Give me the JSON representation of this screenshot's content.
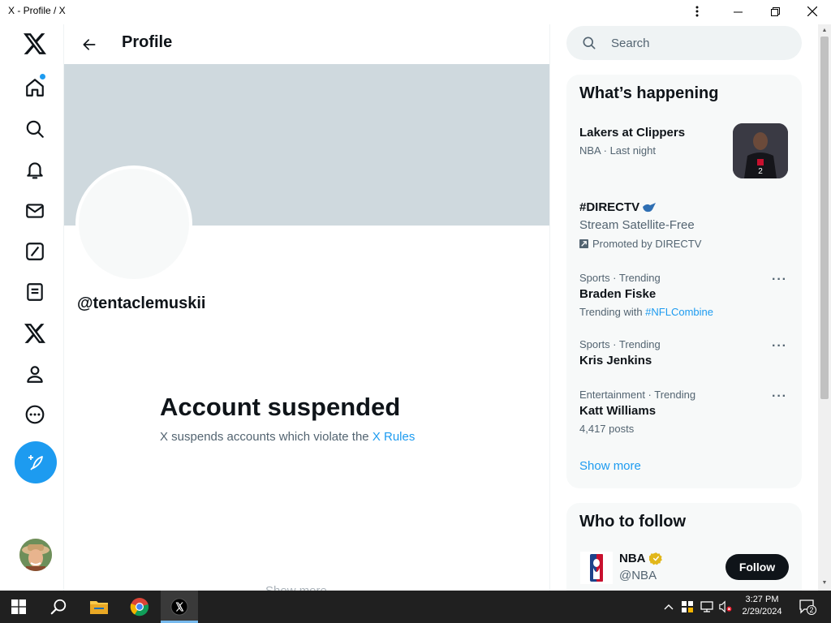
{
  "window": {
    "title": "X - Profile / X"
  },
  "nav": {
    "items": [
      "logo",
      "home",
      "explore",
      "notifications",
      "messages",
      "grok",
      "lists",
      "premium",
      "profile",
      "more"
    ],
    "post_button": "Post"
  },
  "main": {
    "title": "Profile",
    "handle": "@tentaclemuskii",
    "suspended_title": "Account suspended",
    "suspended_text": "X suspends accounts which violate the ",
    "suspended_link": "X Rules",
    "ghost_text": "Show more"
  },
  "search": {
    "placeholder": "Search"
  },
  "happening": {
    "title": "What’s happening",
    "trends": [
      {
        "name": "Lakers at Clippers",
        "meta": "NBA · Last night"
      },
      {
        "name": "#DIRECTV",
        "sub": "Stream Satellite-Free",
        "promo": "Promoted by DIRECTV"
      },
      {
        "meta": "Sports · Trending",
        "name": "Braden Fiske",
        "sub_prefix": "Trending with ",
        "sub_link": "#NFLCombine"
      },
      {
        "meta": "Sports · Trending",
        "name": "Kris Jenkins"
      },
      {
        "meta": "Entertainment · Trending",
        "name": "Katt Williams",
        "sub": "4,417 posts"
      }
    ],
    "show_more": "Show more"
  },
  "follow": {
    "title": "Who to follow",
    "accounts": [
      {
        "name": "NBA",
        "handle": "@NBA",
        "button": "Follow"
      }
    ]
  },
  "taskbar": {
    "time": "3:27 PM",
    "date": "2/29/2024",
    "notification_count": "2"
  },
  "colors": {
    "accent": "#1d9bf0",
    "text": "#0f1419",
    "muted": "#536471",
    "banner": "#cfd9de"
  }
}
